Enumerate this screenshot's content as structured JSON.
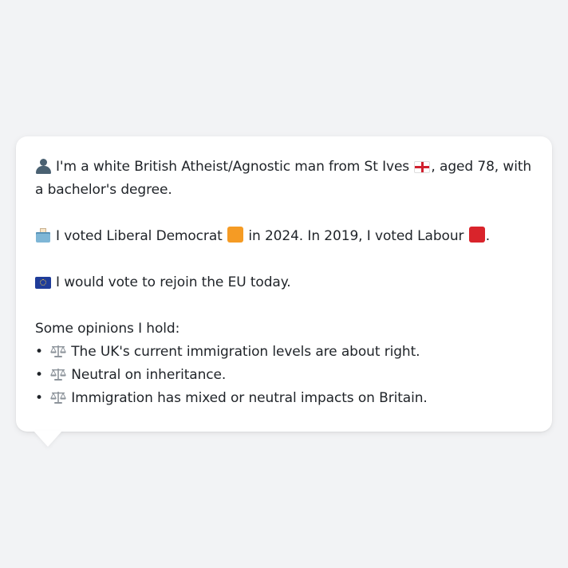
{
  "profile": {
    "identity": {
      "text": "I'm a white British Atheist/Agnostic man from St Ives",
      "suffix": ", aged 78, with a bachelor's degree.",
      "icon": "person-silhouette-icon",
      "flag_icon": "england-flag-icon"
    },
    "voting": {
      "part1": "I voted Liberal Democrat",
      "part2": "in 2024. In 2019, I voted Labour",
      "part3": ".",
      "icon": "ballot-box-icon",
      "liberal_democrat_color": "#f59b24",
      "labour_color": "#d9242b"
    },
    "eu": {
      "text": "I would vote to rejoin the EU today.",
      "icon": "eu-flag-icon"
    },
    "opinions": {
      "heading": "Some opinions I hold:",
      "bullet": "•",
      "items": [
        {
          "text": "The UK's current immigration levels are about right.",
          "icon": "balance-scale-icon"
        },
        {
          "text": "Neutral on inheritance.",
          "icon": "balance-scale-icon"
        },
        {
          "text": "Immigration has mixed or neutral impacts on Britain.",
          "icon": "balance-scale-icon"
        }
      ]
    }
  },
  "colors": {
    "background": "#f2f3f5",
    "bubble": "#ffffff",
    "text": "#1f2328"
  }
}
